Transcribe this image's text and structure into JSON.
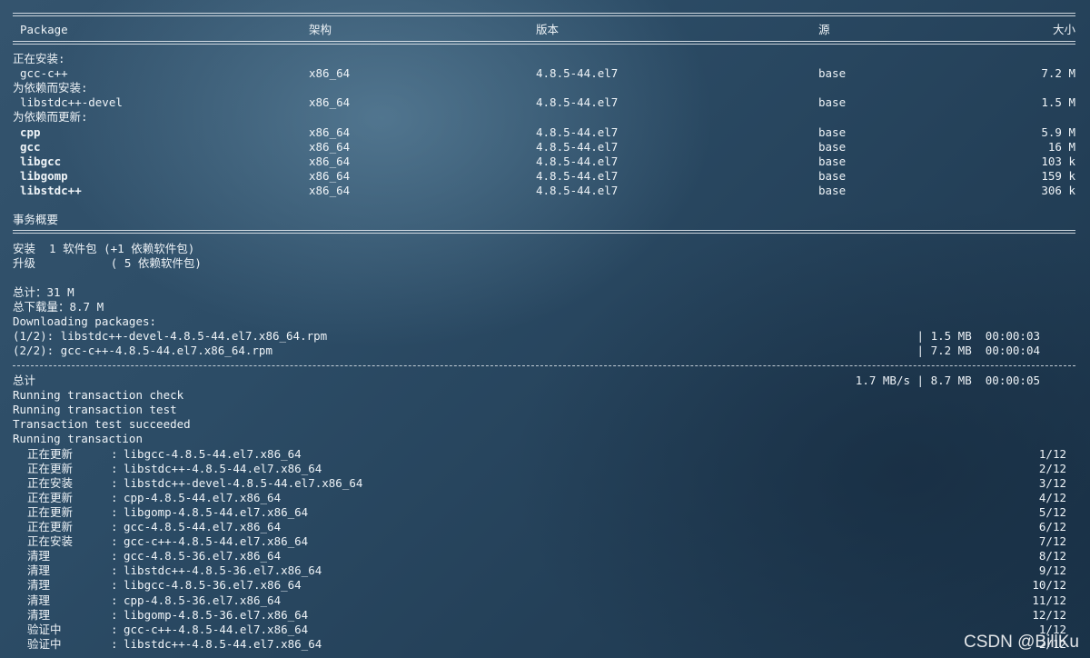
{
  "header": {
    "package": "Package",
    "arch": "架构",
    "version": "版本",
    "repo": "源",
    "size": "大小"
  },
  "sections": [
    {
      "title": "正在安装:",
      "rows": [
        {
          "name": "gcc-c++",
          "arch": "x86_64",
          "version": "4.8.5-44.el7",
          "repo": "base",
          "size": "7.2 M"
        }
      ]
    },
    {
      "title": "为依赖而安装:",
      "rows": [
        {
          "name": "libstdc++-devel",
          "arch": "x86_64",
          "version": "4.8.5-44.el7",
          "repo": "base",
          "size": "1.5 M"
        }
      ]
    },
    {
      "title": "为依赖而更新:",
      "rows": [
        {
          "name": "cpp",
          "arch": "x86_64",
          "version": "4.8.5-44.el7",
          "repo": "base",
          "size": "5.9 M"
        },
        {
          "name": "gcc",
          "arch": "x86_64",
          "version": "4.8.5-44.el7",
          "repo": "base",
          "size": "16 M"
        },
        {
          "name": "libgcc",
          "arch": "x86_64",
          "version": "4.8.5-44.el7",
          "repo": "base",
          "size": "103 k"
        },
        {
          "name": "libgomp",
          "arch": "x86_64",
          "version": "4.8.5-44.el7",
          "repo": "base",
          "size": "159 k"
        },
        {
          "name": "libstdc++",
          "arch": "x86_64",
          "version": "4.8.5-44.el7",
          "repo": "base",
          "size": "306 k"
        }
      ]
    }
  ],
  "summary": {
    "title": "事务概要",
    "install_line": "安装  1 软件包 (+1 依赖软件包)",
    "upgrade_line": "升级           ( 5 依赖软件包)",
    "total_line": "总计：31 M",
    "total_download_line": "总下载量：8.7 M",
    "downloading_label": "Downloading packages:"
  },
  "downloads": [
    {
      "label": "(1/2): libstdc++-devel-4.8.5-44.el7.x86_64.rpm",
      "stats": "| 1.5 MB  00:00:03"
    },
    {
      "label": "(2/2): gcc-c++-4.8.5-44.el7.x86_64.rpm",
      "stats": "| 7.2 MB  00:00:04"
    }
  ],
  "total_download": {
    "label": "总计",
    "stats": "1.7 MB/s | 8.7 MB  00:00:05"
  },
  "transaction": [
    "Running transaction check",
    "Running transaction test",
    "Transaction test succeeded",
    "Running transaction"
  ],
  "steps": [
    {
      "action": "正在更新",
      "package": "libgcc-4.8.5-44.el7.x86_64",
      "progress": "1/12"
    },
    {
      "action": "正在更新",
      "package": "libstdc++-4.8.5-44.el7.x86_64",
      "progress": "2/12"
    },
    {
      "action": "正在安装",
      "package": "libstdc++-devel-4.8.5-44.el7.x86_64",
      "progress": "3/12"
    },
    {
      "action": "正在更新",
      "package": "cpp-4.8.5-44.el7.x86_64",
      "progress": "4/12"
    },
    {
      "action": "正在更新",
      "package": "libgomp-4.8.5-44.el7.x86_64",
      "progress": "5/12"
    },
    {
      "action": "正在更新",
      "package": "gcc-4.8.5-44.el7.x86_64",
      "progress": "6/12"
    },
    {
      "action": "正在安装",
      "package": "gcc-c++-4.8.5-44.el7.x86_64",
      "progress": "7/12"
    },
    {
      "action": "清理",
      "package": "gcc-4.8.5-36.el7.x86_64",
      "progress": "8/12"
    },
    {
      "action": "清理",
      "package": "libstdc++-4.8.5-36.el7.x86_64",
      "progress": "9/12"
    },
    {
      "action": "清理",
      "package": "libgcc-4.8.5-36.el7.x86_64",
      "progress": "10/12"
    },
    {
      "action": "清理",
      "package": "cpp-4.8.5-36.el7.x86_64",
      "progress": "11/12"
    },
    {
      "action": "清理",
      "package": "libgomp-4.8.5-36.el7.x86_64",
      "progress": "12/12"
    },
    {
      "action": "验证中",
      "package": "gcc-c++-4.8.5-44.el7.x86_64",
      "progress": "1/12"
    },
    {
      "action": "验证中",
      "package": "libstdc++-4.8.5-44.el7.x86_64",
      "progress": "2/12"
    }
  ],
  "watermark": "CSDN @BillKu"
}
